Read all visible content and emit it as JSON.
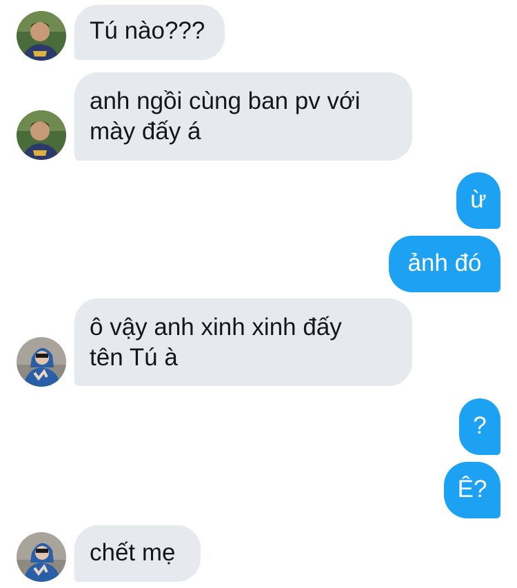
{
  "colors": {
    "incoming_bubble": "#e6eaee",
    "outgoing_bubble": "#1da1f2",
    "incoming_text": "#14171a",
    "outgoing_text": "#ffffff"
  },
  "messages": [
    {
      "direction": "incoming",
      "sender_avatar": "avatar-1",
      "lines": [
        "Tú nào???"
      ]
    },
    {
      "direction": "incoming",
      "sender_avatar": "avatar-1",
      "lines": [
        "anh ngồi cùng ban pv với",
        "mày đấy á"
      ]
    },
    {
      "direction": "outgoing",
      "lines": [
        "ừ"
      ]
    },
    {
      "direction": "outgoing",
      "lines": [
        "ảnh đó"
      ]
    },
    {
      "direction": "incoming",
      "sender_avatar": "avatar-2",
      "lines": [
        "ô vậy anh xinh xinh đấy",
        "tên Tú à"
      ]
    },
    {
      "direction": "outgoing",
      "lines": [
        "?"
      ]
    },
    {
      "direction": "outgoing",
      "lines": [
        "Ê?"
      ]
    },
    {
      "direction": "incoming",
      "sender_avatar": "avatar-2",
      "lines": [
        "chết mẹ"
      ]
    }
  ]
}
